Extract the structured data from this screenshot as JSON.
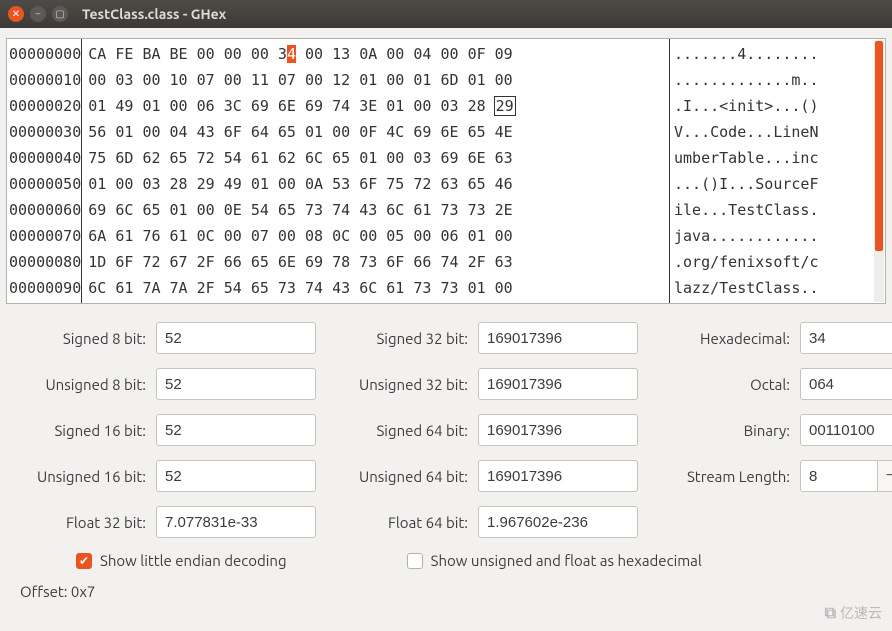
{
  "window": {
    "title": "TestClass.class - GHex"
  },
  "hex": {
    "offsets": [
      "00000000",
      "00000010",
      "00000020",
      "00000030",
      "00000040",
      "00000050",
      "00000060",
      "00000070",
      "00000080",
      "00000090"
    ],
    "rows": [
      [
        "CA",
        "FE",
        "BA",
        "BE",
        "00",
        "00",
        "00",
        "34",
        "00",
        "13",
        "0A",
        "00",
        "04",
        "00",
        "0F",
        "09"
      ],
      [
        "00",
        "03",
        "00",
        "10",
        "07",
        "00",
        "11",
        "07",
        "00",
        "12",
        "01",
        "00",
        "01",
        "6D",
        "01",
        "00"
      ],
      [
        "01",
        "49",
        "01",
        "00",
        "06",
        "3C",
        "69",
        "6E",
        "69",
        "74",
        "3E",
        "01",
        "00",
        "03",
        "28",
        "29"
      ],
      [
        "56",
        "01",
        "00",
        "04",
        "43",
        "6F",
        "64",
        "65",
        "01",
        "00",
        "0F",
        "4C",
        "69",
        "6E",
        "65",
        "4E"
      ],
      [
        "75",
        "6D",
        "62",
        "65",
        "72",
        "54",
        "61",
        "62",
        "6C",
        "65",
        "01",
        "00",
        "03",
        "69",
        "6E",
        "63"
      ],
      [
        "01",
        "00",
        "03",
        "28",
        "29",
        "49",
        "01",
        "00",
        "0A",
        "53",
        "6F",
        "75",
        "72",
        "63",
        "65",
        "46"
      ],
      [
        "69",
        "6C",
        "65",
        "01",
        "00",
        "0E",
        "54",
        "65",
        "73",
        "74",
        "43",
        "6C",
        "61",
        "73",
        "73",
        "2E"
      ],
      [
        "6A",
        "61",
        "76",
        "61",
        "0C",
        "00",
        "07",
        "00",
        "08",
        "0C",
        "00",
        "05",
        "00",
        "06",
        "01",
        "00"
      ],
      [
        "1D",
        "6F",
        "72",
        "67",
        "2F",
        "66",
        "65",
        "6E",
        "69",
        "78",
        "73",
        "6F",
        "66",
        "74",
        "2F",
        "63"
      ],
      [
        "6C",
        "61",
        "7A",
        "7A",
        "2F",
        "54",
        "65",
        "73",
        "74",
        "43",
        "6C",
        "61",
        "73",
        "73",
        "01",
        "00"
      ]
    ],
    "ascii": [
      ".......4........",
      ".............m..",
      ".I...<init>...()",
      "V...Code...LineN",
      "umberTable...inc",
      "...()I...SourceF",
      "ile...TestClass.",
      "java............",
      ".org/fenixsoft/c",
      "lazz/TestClass.."
    ],
    "highlight_row": 0,
    "highlight_col": 7,
    "highlight_half": 1,
    "cursor_row": 2,
    "cursor_col": 15
  },
  "labels": {
    "s8": "Signed 8 bit:",
    "u8": "Unsigned 8 bit:",
    "s16": "Signed 16 bit:",
    "u16": "Unsigned 16 bit:",
    "f32": "Float 32 bit:",
    "s32": "Signed 32 bit:",
    "u32": "Unsigned 32 bit:",
    "s64": "Signed 64 bit:",
    "u64": "Unsigned 64 bit:",
    "f64": "Float 64 bit:",
    "hex": "Hexadecimal:",
    "oct": "Octal:",
    "bin": "Binary:",
    "slen": "Stream Length:"
  },
  "values": {
    "s8": "52",
    "u8": "52",
    "s16": "52",
    "u16": "52",
    "f32": "7.077831e-33",
    "s32": "169017396",
    "u32": "169017396",
    "s64": "169017396",
    "u64": "169017396",
    "f64": "1.967602e-236",
    "hex": "34",
    "oct": "064",
    "bin": "00110100",
    "slen": "8"
  },
  "checks": {
    "little_endian_label": "Show little endian decoding",
    "little_endian_checked": true,
    "unsigned_hex_label": "Show unsigned and float as hexadecimal",
    "unsigned_hex_checked": false
  },
  "offset_label": "Offset: 0x7",
  "watermark": "亿速云"
}
